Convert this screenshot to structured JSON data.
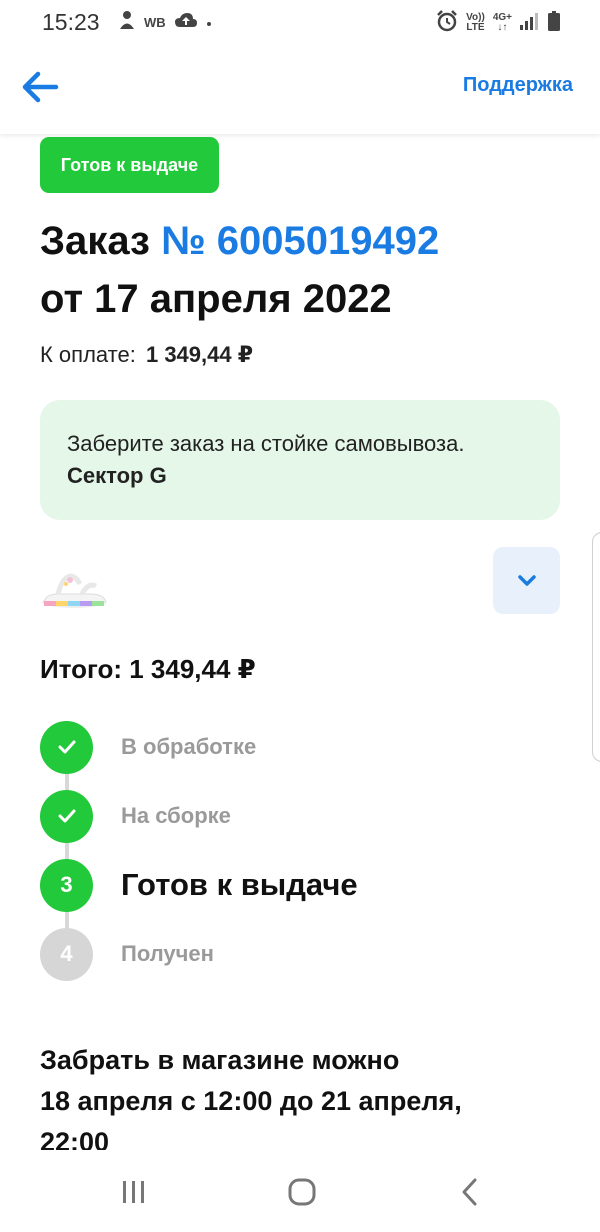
{
  "status_bar": {
    "time": "15:23",
    "wb_label": "WB",
    "lte_line1": "Vo))",
    "lte_line2": "LTE",
    "net_line1": "4G+"
  },
  "header": {
    "support_label": "Поддержка",
    "accent_color": "#1a7ce2"
  },
  "order": {
    "status_chip": "Готов к выдаче",
    "title_prefix": "Заказ",
    "number": "№ 6005019492",
    "date_line": "от 17 апреля 2022",
    "pay_label": "К оплате:",
    "pay_amount": "1 349,44 ₽"
  },
  "pickup_notice": {
    "text": "Заберите заказ на стойке самовывоза.",
    "sector": "Сектор G"
  },
  "total": {
    "text": "Итого: 1 349,44 ₽"
  },
  "steps": [
    {
      "marker": "✓",
      "label": "В обработке",
      "state": "done"
    },
    {
      "marker": "✓",
      "label": "На сборке",
      "state": "done"
    },
    {
      "marker": "3",
      "label": "Готов к выдаче",
      "state": "current"
    },
    {
      "marker": "4",
      "label": "Получен",
      "state": "todo"
    }
  ],
  "pickup_window": {
    "line1": "Забрать в магазине можно",
    "line2": "18 апреля с 12:00 до 21 апреля,",
    "line3": "22:00"
  },
  "colors": {
    "green": "#22c93b",
    "pickup_bg": "#e5f7e8",
    "grey_step": "#d6d6d6"
  }
}
